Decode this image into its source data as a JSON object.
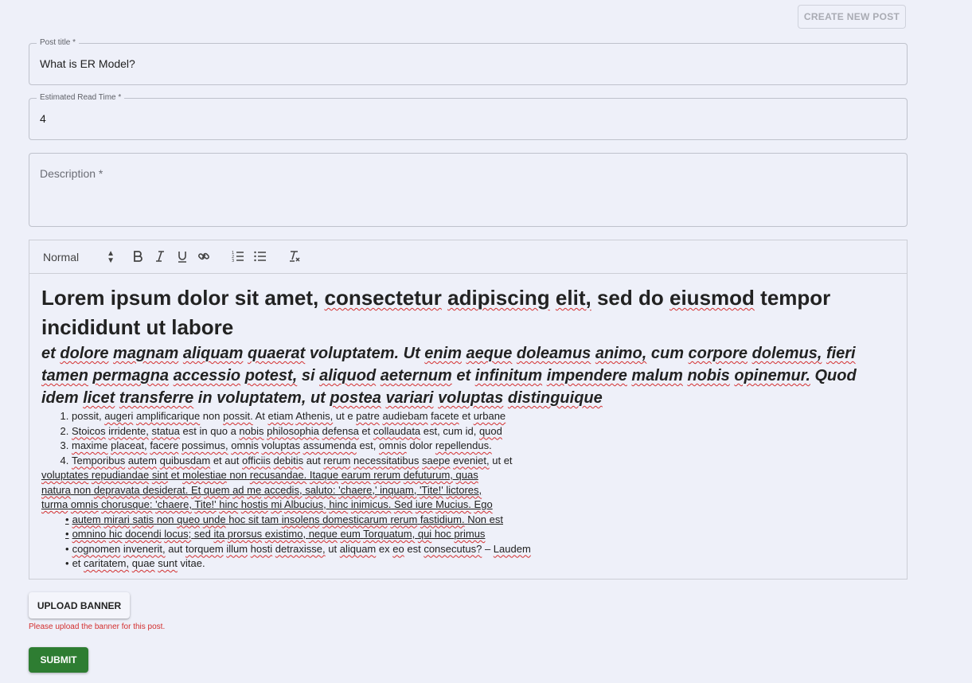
{
  "header": {
    "create_post_label": "CREATE NEW POST"
  },
  "form": {
    "title": {
      "label": "Post title *",
      "value": "What is ER Model?"
    },
    "read_time": {
      "label": "Estimated Read Time *",
      "value": "4"
    },
    "description": {
      "placeholder": "Description *"
    }
  },
  "editor": {
    "toolbar": {
      "format_select": "Normal",
      "icons": [
        "bold-icon",
        "italic-icon",
        "underline-icon",
        "link-icon",
        "ordered-list-icon",
        "bullet-list-icon",
        "clear-format-icon"
      ]
    },
    "heading1": "Lorem ipsum dolor sit amet, consectetur adipiscing elit, sed do eiusmod tempor incididunt ut labore",
    "heading2": "et dolore magnam aliquam quaerat voluptatem. Ut enim aeque doleamus animo, cum corpore dolemus, fieri tamen permagna accessio potest, si aliquod aeternum et infinitum impendere malum nobis opinemur. Quod idem licet transferre in voluptatem, ut postea variari voluptas distinguique",
    "ordered_items": [
      "possit, augeri amplificarique non possit. At etiam Athenis, ut e patre audiebam facete et urbane",
      "Stoicos irridente, statua est in quo a nobis philosophia defensa et collaudata est, cum id, quod",
      "maxime placeat, facere possimus, omnis voluptas assumenda est, omnis dolor repellendus.",
      "Temporibus autem quibusdam et aut officiis debitis aut rerum necessitatibus saepe eveniet, ut et"
    ],
    "continuation_lines": [
      "voluptates repudiandae sint et molestiae non recusandae. Itaque earum rerum defuturum, quas",
      "natura non depravata desiderat. Et quem ad me accedis, saluto: 'chaere,' inquam, 'Tite!' lictores,",
      "turma omnis chorusque: 'chaere, Tite!' hinc hostis mi Albucius, hinc inimicus. Sed iure Mucius. Ego"
    ],
    "bullet_items": [
      "autem mirari satis non queo unde hoc sit tam insolens domesticarum rerum fastidium. Non est",
      "omnino hic docendi locus; sed ita prorsus existimo, neque eum Torquatum, qui hoc primus",
      "cognomen invenerit, aut torquem illum hosti detraxisse, ut aliquam ex eo est consecutus? – Laudem",
      "et caritatem, quae sunt vitae."
    ]
  },
  "upload": {
    "label": "UPLOAD BANNER",
    "error": "Please upload the banner for this post."
  },
  "submit": {
    "label": "SUBMIT"
  },
  "colors": {
    "submit_bg": "#2e7d32",
    "error": "#d32f2f",
    "page_bg": "#eef0f9"
  }
}
